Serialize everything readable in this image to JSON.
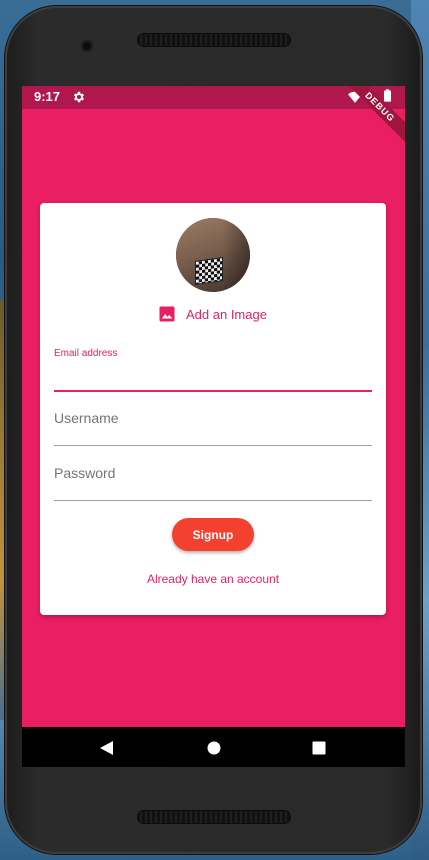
{
  "status_bar": {
    "time": "9:17",
    "settings_icon": "gear-icon",
    "wifi_icon": "wifi-icon",
    "battery_icon": "battery-icon",
    "debug_banner": "DEBUG"
  },
  "colors": {
    "primary": "#e91e63",
    "status_bar": "#b0174d",
    "button": "#f4412f",
    "card": "#ffffff",
    "nav_bar": "#000000"
  },
  "form": {
    "avatar_alt": "profile-photo",
    "add_image_icon": "image-icon",
    "add_image_label": "Add an Image",
    "email": {
      "label": "Email address",
      "value": ""
    },
    "username": {
      "placeholder": "Username",
      "value": ""
    },
    "password": {
      "placeholder": "Password",
      "value": ""
    },
    "signup_label": "Signup",
    "already_label": "Already have an account"
  },
  "nav_bar": {
    "back_icon": "back-triangle-icon",
    "home_icon": "home-circle-icon",
    "recents_icon": "recents-square-icon"
  }
}
